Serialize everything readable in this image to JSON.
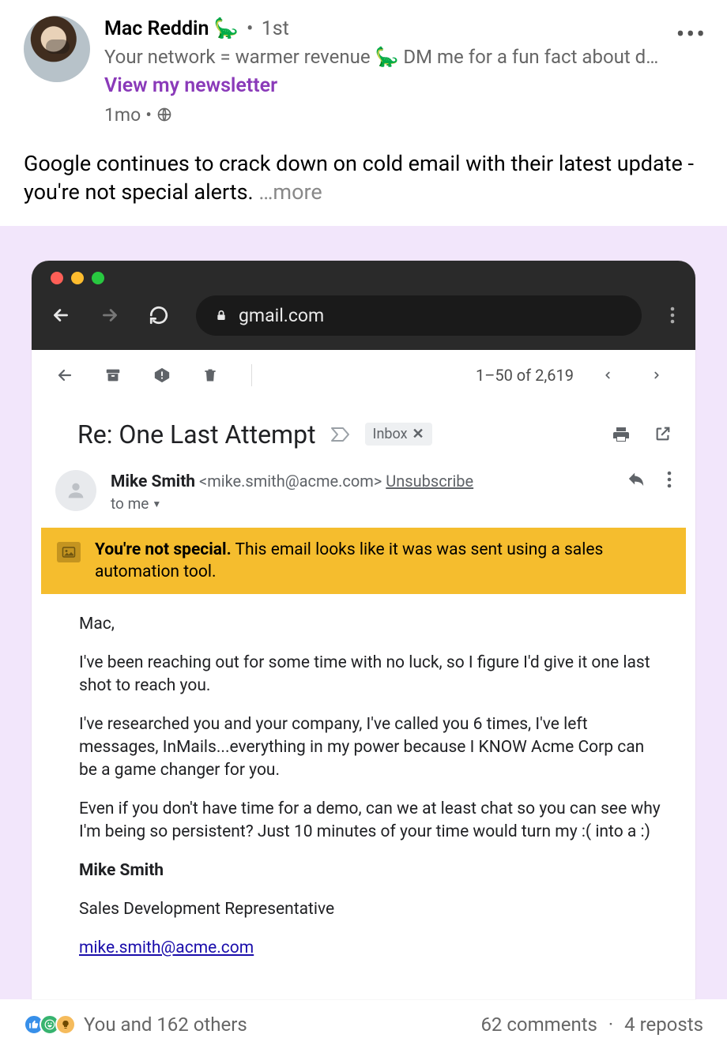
{
  "author": {
    "name": "Mac Reddin 🦕",
    "degree": "1st",
    "tagline": "Your network = warmer revenue 🦕 DM me for a fun fact about d…",
    "newsletter_link": "View my newsletter",
    "timestamp": "1mo"
  },
  "post": {
    "body": "Google continues to crack down on cold email with their latest update - you're not special alerts.  ",
    "see_more": "…more"
  },
  "browser": {
    "url": "gmail.com"
  },
  "gmail": {
    "count_label": "1–50 of 2,619",
    "subject": "Re: One Last Attempt",
    "label_chip": "Inbox",
    "sender": {
      "name": "Mike Smith",
      "email": "<mike.smith@acme.com>",
      "unsubscribe": "Unsubscribe",
      "to_line": "to me"
    },
    "alert": {
      "strong": "You're not special.",
      "text": " This email looks like it was was sent using a sales automation tool."
    },
    "body": {
      "p1": "Mac,",
      "p2": "I've been reaching out for some time with no luck, so I figure I'd give it one last shot to reach you.",
      "p3": "I've researched you and your company, I've called you 6 times, I've left messages, InMails...everything in my power because I KNOW Acme Corp can be a game changer for you.",
      "p4": "Even if you don't have time for a demo, can we at least chat so you can see why I'm being so persistent? Just 10 minutes of your time would turn my :( into a :)",
      "sig_name": "Mike Smith",
      "sig_title": "Sales Development Representative",
      "sig_email": "mike.smith@acme.com"
    }
  },
  "engagement": {
    "likes_text": "You and 162 others",
    "comments": "62 comments",
    "reposts": "4 reposts"
  }
}
